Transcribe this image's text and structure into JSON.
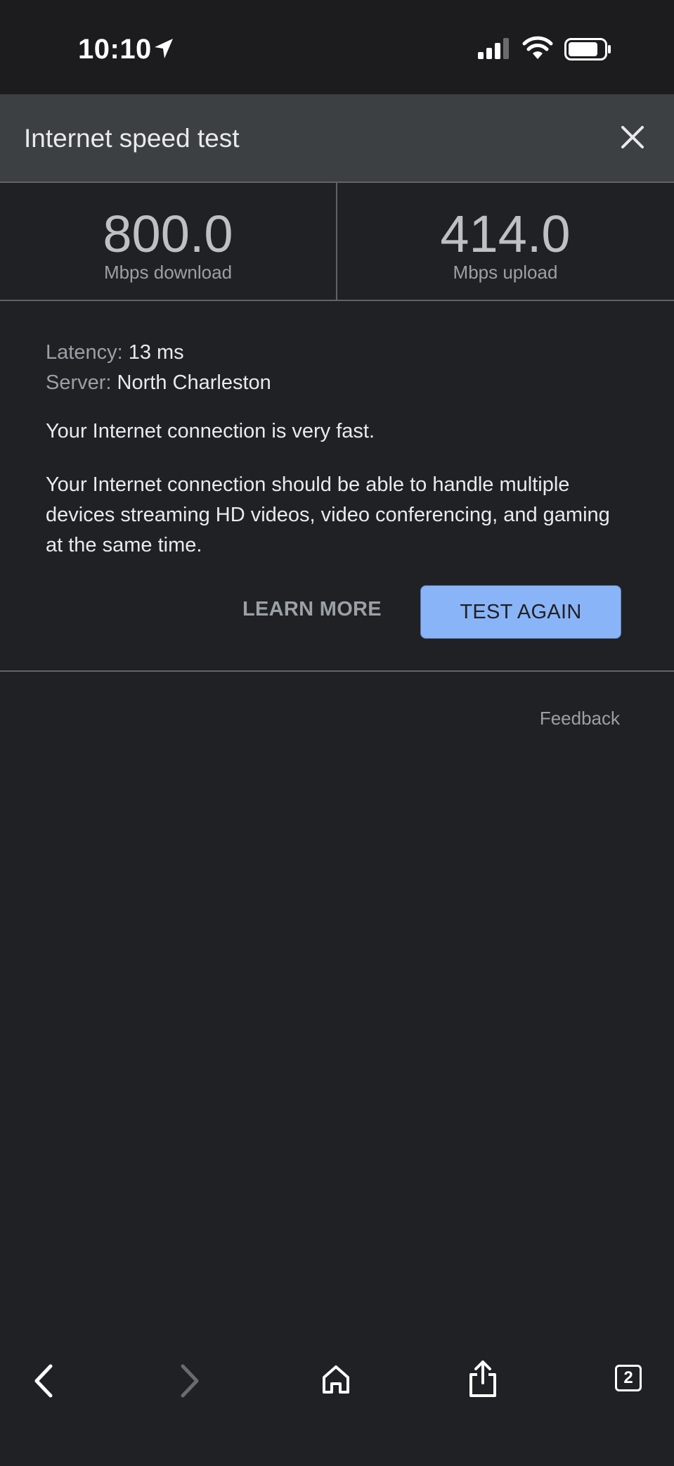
{
  "status_bar": {
    "time": "10:10",
    "icons": [
      "location-arrow-icon",
      "cellular-signal-icon",
      "wifi-icon",
      "battery-icon"
    ]
  },
  "header": {
    "title": "Internet speed test",
    "close_icon": "close-icon"
  },
  "metrics": {
    "download": {
      "value": "800.0",
      "label": "Mbps download"
    },
    "upload": {
      "value": "414.0",
      "label": "Mbps upload"
    }
  },
  "details": {
    "latency_key": "Latency:",
    "latency_value": "13 ms",
    "server_key": "Server:",
    "server_value": "North Charleston"
  },
  "summary": "Your Internet connection is very fast.",
  "description": "Your Internet connection should be able to handle multiple devices streaming HD videos, video conferencing, and gaming at the same time.",
  "actions": {
    "learn_more": "LEARN MORE",
    "test_again": "TEST AGAIN"
  },
  "feedback": "Feedback",
  "toolbar": {
    "tab_count": "2",
    "icons": [
      "back-icon",
      "forward-icon",
      "home-icon",
      "share-icon",
      "tabs-icon"
    ]
  },
  "colors": {
    "background": "#202124",
    "header": "#3c4043",
    "accent": "#8ab4f8"
  }
}
